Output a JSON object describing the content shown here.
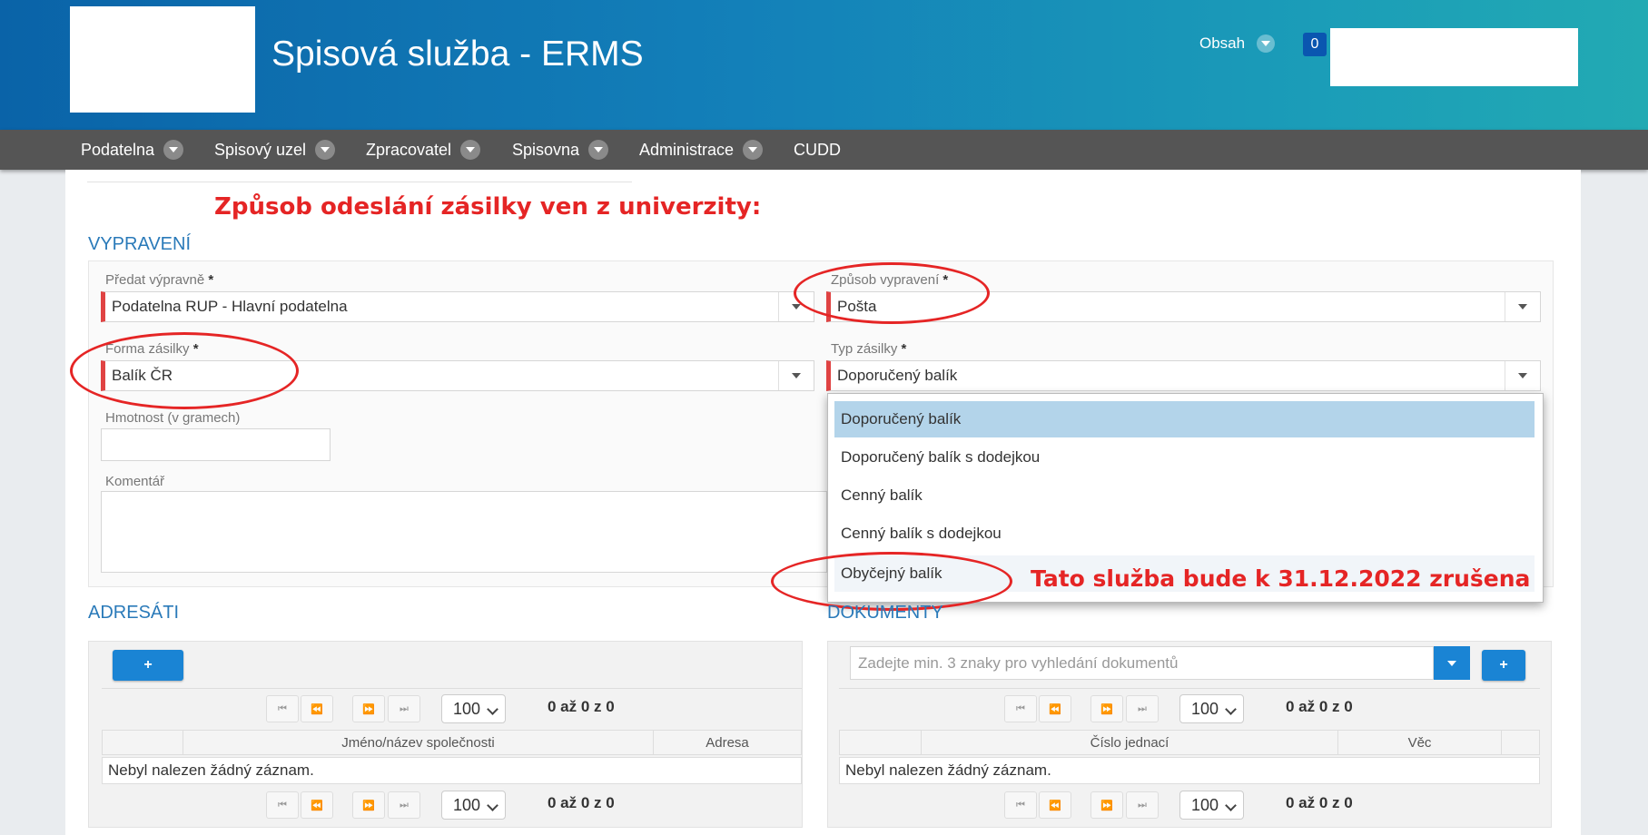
{
  "header": {
    "app_title": "Spisová služba - ERMS",
    "menu_label": "Obsah",
    "notification_count": "0"
  },
  "nav": {
    "items": [
      {
        "label": "Podatelna",
        "has_dropdown": true
      },
      {
        "label": "Spisový uzel",
        "has_dropdown": true
      },
      {
        "label": "Zpracovatel",
        "has_dropdown": true
      },
      {
        "label": "Spisovna",
        "has_dropdown": true
      },
      {
        "label": "Administrace",
        "has_dropdown": true
      },
      {
        "label": "CUDD",
        "has_dropdown": false
      }
    ]
  },
  "annotation": {
    "heading": "Způsob odeslání zásilky ven z univerzity:",
    "note": "Tato služba bude k 31.12.2022 zrušena",
    "color": "#e52525"
  },
  "vypraveni": {
    "title": "VYPRAVENÍ",
    "predat": {
      "label": "Předat výpravně",
      "required": "*",
      "value": "Podatelna RUP - Hlavní podatelna"
    },
    "zpusob": {
      "label": "Způsob vypravení",
      "required": "*",
      "value": "Pošta"
    },
    "forma": {
      "label": "Forma zásilky",
      "required": "*",
      "value": "Balík ČR"
    },
    "typ": {
      "label": "Typ zásilky",
      "required": "*",
      "value": "Doporučený balík"
    },
    "hmotnost": {
      "label": "Hmotnost (v gramech)",
      "value": ""
    },
    "komentar": {
      "label": "Komentář",
      "value": ""
    },
    "typ_options": [
      "Doporučený balík",
      "Doporučený balík s dodejkou",
      "Cenný balík",
      "Cenný balík s dodejkou",
      "Obyčejný balík"
    ],
    "selected_option": "Doporučený balík"
  },
  "adresati": {
    "title": "ADRESÁTI",
    "add_button": "+",
    "page_size": "100",
    "range_info": "0 až 0 z 0",
    "columns": [
      "Jméno/název společnosti",
      "Adresa"
    ],
    "empty_text": "Nebyl nalezen žádný záznam."
  },
  "dokumenty": {
    "title": "DOKUMENTY",
    "search_placeholder": "Zadejte min. 3 znaky pro vyhledání dokumentů",
    "add_button": "+",
    "page_size": "100",
    "range_info": "0 až 0 z 0",
    "columns": [
      "Číslo jednací",
      "Věc"
    ],
    "empty_text": "Nebyl nalezen žádný záznam."
  },
  "colors": {
    "header_start": "#0a63a8",
    "header_end": "#22aab3",
    "nav_bg": "#555555",
    "accent_blue": "#1a84d4",
    "required_marker": "#e04343",
    "selected_option_bg": "#b3d4ea"
  },
  "icons": {
    "first": "⏮",
    "prev": "⏪",
    "next": "⏩",
    "last": "⏭"
  }
}
